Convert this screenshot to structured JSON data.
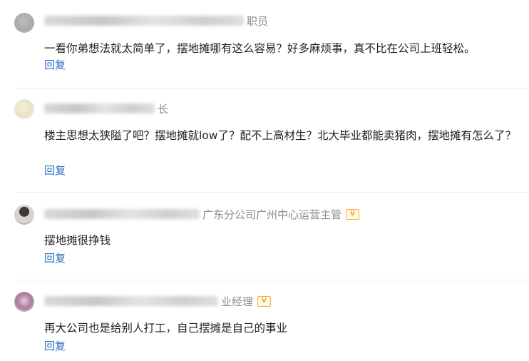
{
  "comments": [
    {
      "title_suffix": "职员",
      "verified": false,
      "text": "一看你弟想法就太简单了，摆地摊哪有这么容易？好多麻烦事，真不比在公司上班轻松。",
      "reply_label": "回复",
      "avatar": "gray-blurred-avatar"
    },
    {
      "title_suffix": "长",
      "verified": false,
      "text": "楼主思想太狭隘了吧？摆地摊就low了？配不上高材生？北大毕业都能卖猪肉，摆地摊有怎么了？",
      "reply_label": "回复",
      "avatar": "blurred-pale-avatar"
    },
    {
      "title_suffix": "广东分公司广州中心运营主管",
      "verified": true,
      "text": "摆地摊很挣钱",
      "reply_label": "回复",
      "avatar": "person-photo-avatar"
    },
    {
      "title_suffix": "业经理",
      "verified": true,
      "text": "再大公司也是给别人打工，自己摆摊是自己的事业",
      "reply_label": "回复",
      "avatar": "purple-blurred-avatar"
    }
  ],
  "badge_label": "V",
  "colors": {
    "link": "#2f6fc4",
    "meta": "#8a8a8a",
    "badge": "#f2a60c"
  }
}
